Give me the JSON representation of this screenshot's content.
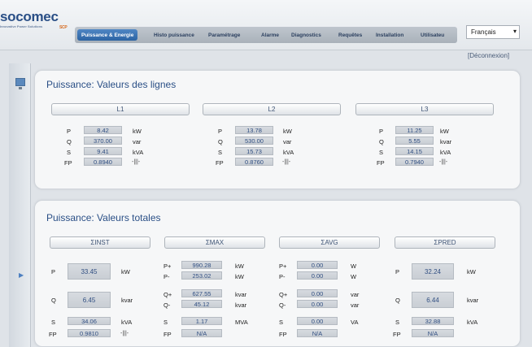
{
  "brand": {
    "name": "socomec",
    "sub": "Innovative Power Solutions",
    "scp": "SCP"
  },
  "nav": {
    "items": [
      {
        "label": "Puissance & Energie",
        "active": true
      },
      {
        "label": "Histo puissance",
        "active": false
      },
      {
        "label": "Paramétrage",
        "active": false
      },
      {
        "label": "Alarme",
        "active": false
      },
      {
        "label": "Diagnostics",
        "active": false
      },
      {
        "label": "Requêtes",
        "active": false
      },
      {
        "label": "Installation",
        "active": false
      },
      {
        "label": "Utilisateu",
        "active": false
      }
    ]
  },
  "lang": {
    "value": "Français"
  },
  "logout": "[Déconnexion]",
  "lines": {
    "title": "Puissance: Valeurs des lignes",
    "columns": [
      {
        "button": "L1",
        "P": "8.42",
        "P_unit": "kW",
        "Q": "370.00",
        "Q_unit": "var",
        "S": "9.41",
        "S_unit": "kVA",
        "FP": "0.8940"
      },
      {
        "button": "L2",
        "P": "13.78",
        "P_unit": "kW",
        "Q": "530.00",
        "Q_unit": "var",
        "S": "15.73",
        "S_unit": "kVA",
        "FP": "0.8760"
      },
      {
        "button": "L3",
        "P": "11.25",
        "P_unit": "kW",
        "Q": "5.55",
        "Q_unit": "kvar",
        "S": "14.15",
        "S_unit": "kVA",
        "FP": "0.7940"
      }
    ]
  },
  "totals": {
    "title": "Puissance: Valeurs totales",
    "buttons": [
      "ΣINST",
      "ΣMAX",
      "ΣAVG",
      "ΣPRED"
    ],
    "inst": {
      "P": "33.45",
      "P_unit": "kW",
      "Q": "6.45",
      "Q_unit": "kvar",
      "S": "34.06",
      "S_unit": "kVA",
      "FP": "0.9810"
    },
    "max": {
      "Pp": "990.28",
      "Pm": "253.02",
      "P_unit": "kW",
      "Pm_unit": "kW",
      "Qp": "627.55",
      "Qm": "45.12",
      "Q_unit": "kvar",
      "Qm_unit": "kvar",
      "S": "1.17",
      "S_unit": "MVA",
      "FP": "N/A"
    },
    "avg": {
      "Pp": "0.00",
      "Pm": "0.00",
      "P_unit": "W",
      "Pm_unit": "W",
      "Qp": "0.00",
      "Qm": "0.00",
      "Q_unit": "var",
      "Qm_unit": "var",
      "S": "0.00",
      "S_unit": "VA",
      "FP": "N/A"
    },
    "pred": {
      "P": "32.24",
      "P_unit": "kW",
      "Q": "6.44",
      "Q_unit": "kvar",
      "S": "32.88",
      "S_unit": "kVA",
      "FP": "N/A"
    }
  },
  "labels": {
    "P": "P",
    "Q": "Q",
    "S": "S",
    "FP": "FP",
    "Pp": "P+",
    "Pm": "P-",
    "Qp": "Q+",
    "Qm": "Q-"
  },
  "fp_icon": "-|||-"
}
